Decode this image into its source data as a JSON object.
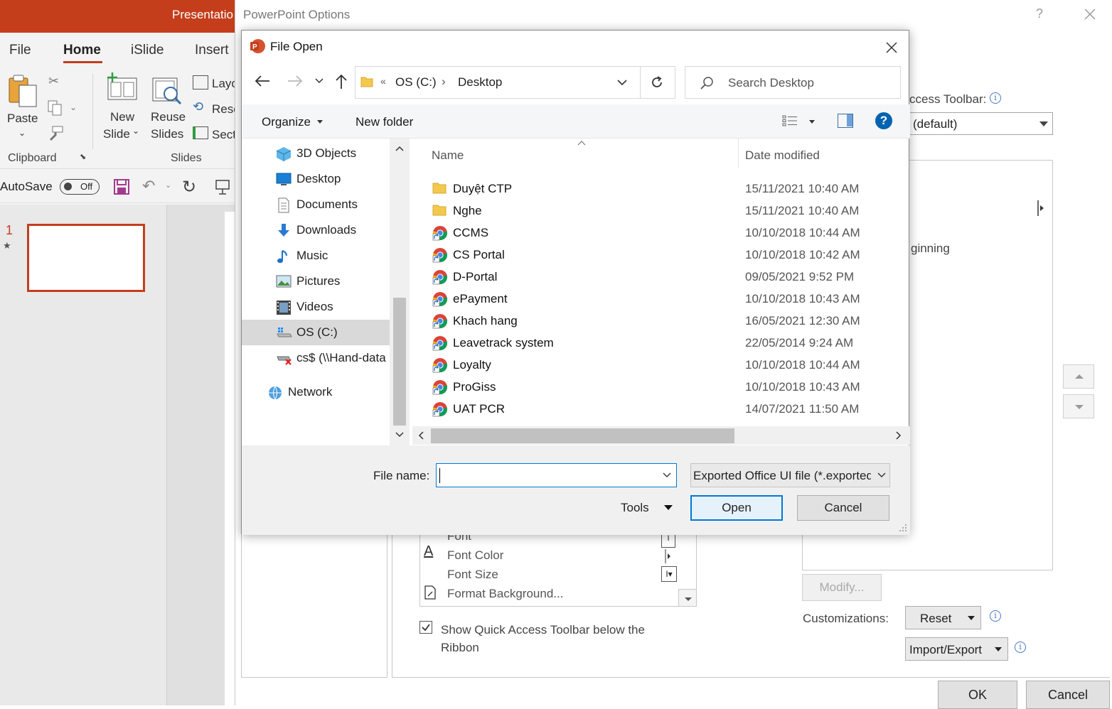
{
  "ppt": {
    "title": "Presentatio",
    "tabs": [
      "File",
      "Home",
      "iSlide",
      "Insert"
    ],
    "ribbon": {
      "paste": "Paste",
      "new_slide_1": "New",
      "new_slide_2": "Slide",
      "reuse_1": "Reuse",
      "reuse_2": "Slides",
      "layout": "Layo",
      "reset": "Rese",
      "section": "Sect",
      "clipboard": "Clipboard",
      "slides": "Slides"
    },
    "autosave": "AutoSave",
    "toggle": "Off",
    "slide_number": "1"
  },
  "options": {
    "title": "PowerPoint Options",
    "help": "?",
    "qat_label": "ccess Toolbar:",
    "qat_select": "(default)",
    "beginning": "ginning",
    "modify": "Modify...",
    "customizations": "Customizations:",
    "reset": "Reset",
    "import_export": "Import/Export",
    "commands": [
      "Font",
      "Font Color",
      "Font Size",
      "Format Background..."
    ],
    "show_qat": "Show Quick Access Toolbar below the Ribbon",
    "ok": "OK",
    "cancel": "Cancel"
  },
  "file_open": {
    "title": "File Open",
    "breadcrumb": {
      "overflow": "«",
      "drive": "OS (C:)",
      "folder": "Desktop"
    },
    "search_placeholder": "Search Desktop",
    "toolbar": {
      "organize": "Organize",
      "new_folder": "New folder",
      "help": "?"
    },
    "nav_items": [
      {
        "label": "3D Objects",
        "icon": "3d-objects-icon"
      },
      {
        "label": "Desktop",
        "icon": "desktop-icon"
      },
      {
        "label": "Documents",
        "icon": "documents-icon"
      },
      {
        "label": "Downloads",
        "icon": "downloads-icon"
      },
      {
        "label": "Music",
        "icon": "music-icon"
      },
      {
        "label": "Pictures",
        "icon": "pictures-icon"
      },
      {
        "label": "Videos",
        "icon": "videos-icon"
      },
      {
        "label": "OS (C:)",
        "icon": "drive-icon"
      },
      {
        "label": "cs$ (\\\\Hand-data",
        "icon": "network-drive-disconnected-icon"
      },
      {
        "label": "Network",
        "icon": "network-icon"
      }
    ],
    "columns": {
      "name": "Name",
      "date": "Date modified"
    },
    "files": [
      {
        "name": "Duyệt CTP",
        "date": "15/11/2021 10:40 AM",
        "type": "folder"
      },
      {
        "name": "Nghe",
        "date": "15/11/2021 10:40 AM",
        "type": "folder"
      },
      {
        "name": "CCMS",
        "date": "10/10/2018 10:44 AM",
        "type": "shortcut"
      },
      {
        "name": "CS Portal",
        "date": "10/10/2018 10:42 AM",
        "type": "shortcut"
      },
      {
        "name": "D-Portal",
        "date": "09/05/2021 9:52 PM",
        "type": "shortcut"
      },
      {
        "name": "ePayment",
        "date": "10/10/2018 10:43 AM",
        "type": "shortcut"
      },
      {
        "name": "Khach hang",
        "date": "16/05/2021 12:30 AM",
        "type": "shortcut"
      },
      {
        "name": "Leavetrack system",
        "date": "22/05/2014 9:24 AM",
        "type": "shortcut"
      },
      {
        "name": "Loyalty",
        "date": "10/10/2018 10:44 AM",
        "type": "shortcut"
      },
      {
        "name": "ProGiss",
        "date": "10/10/2018 10:43 AM",
        "type": "shortcut"
      },
      {
        "name": "UAT PCR",
        "date": "14/07/2021 11:50 AM",
        "type": "shortcut"
      }
    ],
    "file_name_label": "File name:",
    "file_name_value": "",
    "file_type": "Exported Office UI file (*.exportedUI)",
    "tools": "Tools",
    "open": "Open",
    "cancel": "Cancel"
  }
}
